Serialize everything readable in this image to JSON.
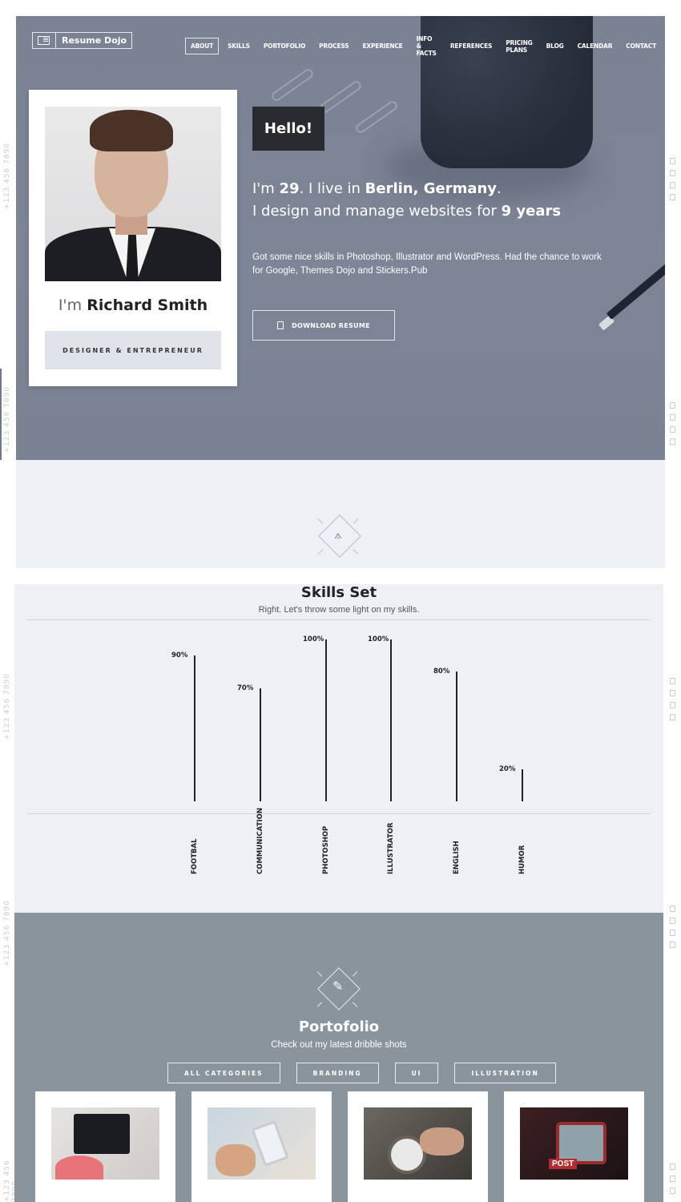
{
  "brand": {
    "name": "Resume Dojo"
  },
  "phone": "+123 456 7890",
  "nav": [
    "ABOUT",
    "SKILLS",
    "PORTOFOLIO",
    "PROCESS",
    "EXPERIENCE",
    "INFO & FACTS",
    "REFERENCES",
    "PRICING PLANS",
    "BLOG",
    "CALENDAR",
    "CONTACT"
  ],
  "nav_active": "ABOUT",
  "profile": {
    "name_prefix": "I'm",
    "name": "Richard Smith",
    "role": "DESIGNER & ENTREPRENEUR"
  },
  "hero": {
    "greeting": "Hello!",
    "line1_a": "I'm ",
    "age": "29",
    "line1_b": ". I live in ",
    "city": "Berlin, Germany",
    "line1_c": ".",
    "line2_a": "I design and manage websites for ",
    "years": "9 years",
    "description": "Got some nice skills in Photoshop, Illustrator and WordPress. Had the chance to work for Google, Themes Dojo and Stickers.Pub",
    "download_label": "DOWNLOAD RESUME"
  },
  "skills": {
    "title": "Skills Set",
    "subtitle": "Right. Let's throw some light on my skills."
  },
  "chart_data": {
    "type": "bar",
    "categories": [
      "FOOTBAL",
      "COMMUNICATION",
      "PHOTOSHOP",
      "ILLUSTRATOR",
      "ENGLISH",
      "HUMOR"
    ],
    "values": [
      90,
      70,
      100,
      100,
      80,
      20
    ],
    "value_labels": [
      "90%",
      "70%",
      "100%",
      "100%",
      "80%",
      "20%"
    ],
    "ylim": [
      0,
      100
    ]
  },
  "portfolio": {
    "title": "Portofolio",
    "subtitle": "Check out my latest dribble shots",
    "filters": [
      "ALL CATEGORIES",
      "BRANDING",
      "UI",
      "ILLUSTRATION"
    ]
  },
  "icons": {
    "social": [
      "facebook-icon",
      "twitter-icon",
      "instagram-icon",
      "dribbble-icon"
    ],
    "download": "file-icon",
    "skills_section": "compass-icon",
    "portfolio_section": "pencil-ruler-icon"
  },
  "colors": {
    "hero_bg": "#7b8294",
    "band_bg": "#edf0f5",
    "portfolio_bg": "#8a949d",
    "accent_dark": "#2a2b30"
  }
}
